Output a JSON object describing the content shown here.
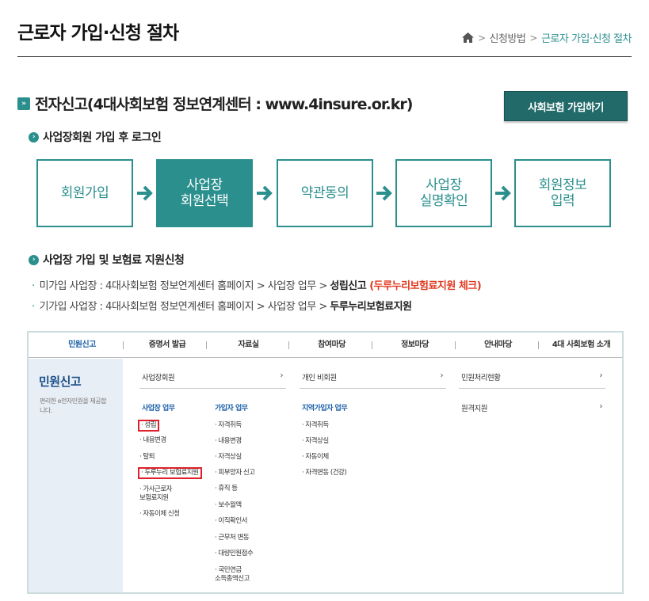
{
  "page": {
    "title": "근로자 가입·신청 절차",
    "breadcrumb": [
      "신청방법",
      "근로자 가입·신청 절차"
    ]
  },
  "section": {
    "icon_text": "»",
    "title": "전자신고(4대사회보험 정보연계센터 : www.4insure.or.kr)",
    "join_button": "사회보험 가입하기"
  },
  "sub1": {
    "icon_text": "›",
    "title": "사업장회원 가입 후 로그인",
    "steps": [
      {
        "label": "회원가입",
        "active": false
      },
      {
        "label": "사업장\n회원선택",
        "active": true
      },
      {
        "label": "약관동의",
        "active": false
      },
      {
        "label": "사업장\n실명확인",
        "active": false
      },
      {
        "label": "회원정보\n입력",
        "active": false
      }
    ]
  },
  "sub2": {
    "icon_text": "›",
    "title": "사업장 가입 및 보험료 지원신청",
    "bullet1": {
      "dot": "·",
      "prefix": "미가입 사업장 : 4대사회보험 정보연계센터 홈페이지 > 사업장 업무 > ",
      "bold": "성립신고",
      "red": " (두루누리보험료지원 체크)"
    },
    "bullet2": {
      "dot": "·",
      "prefix": "기가입 사업장 : 4대사회보험 정보연계센터 홈페이지 > 사업장 업무 > ",
      "bold": "두루누리보험료지원"
    }
  },
  "shot": {
    "nav": [
      "민원신고",
      "증명서 발급",
      "자료실",
      "참여마당",
      "정보마당",
      "안내마당",
      "4대 사회보험 소개"
    ],
    "side_title": "민원신고",
    "side_desc": "편리한 e전자민원을 제공합니다.",
    "rows": [
      "사업장회원",
      "개인 비회원",
      "민원처리현황"
    ],
    "chevron": "›",
    "col1_head": "사업장 업무",
    "col1": [
      "· 성립",
      "· 내용변경",
      "· 탈퇴",
      "· 두루누리 보험료지원",
      "· 가사근로자\n  보험료지원",
      "· 자동이체 신청"
    ],
    "col2_head": "가입자 업무",
    "col2": [
      "· 자격취득",
      "· 내용변경",
      "· 자격상실",
      "· 피부양자 신고",
      "· 휴직 등",
      "· 보수월액",
      "· 이직확인서",
      "· 근무처 변동",
      "· 대량민원접수",
      "· 국민연금\n  소득총액신고"
    ],
    "col3_head": "지역가입자 업무",
    "col3": [
      "· 자격취득",
      "· 자격상실",
      "· 자동이체",
      "· 자격변동 (건강)"
    ],
    "col4": "원격지원"
  },
  "colors": {
    "accent": "#2a8f8d",
    "button": "#226a6a",
    "red": "#e0391f",
    "nav_active": "#1b5fa8"
  }
}
